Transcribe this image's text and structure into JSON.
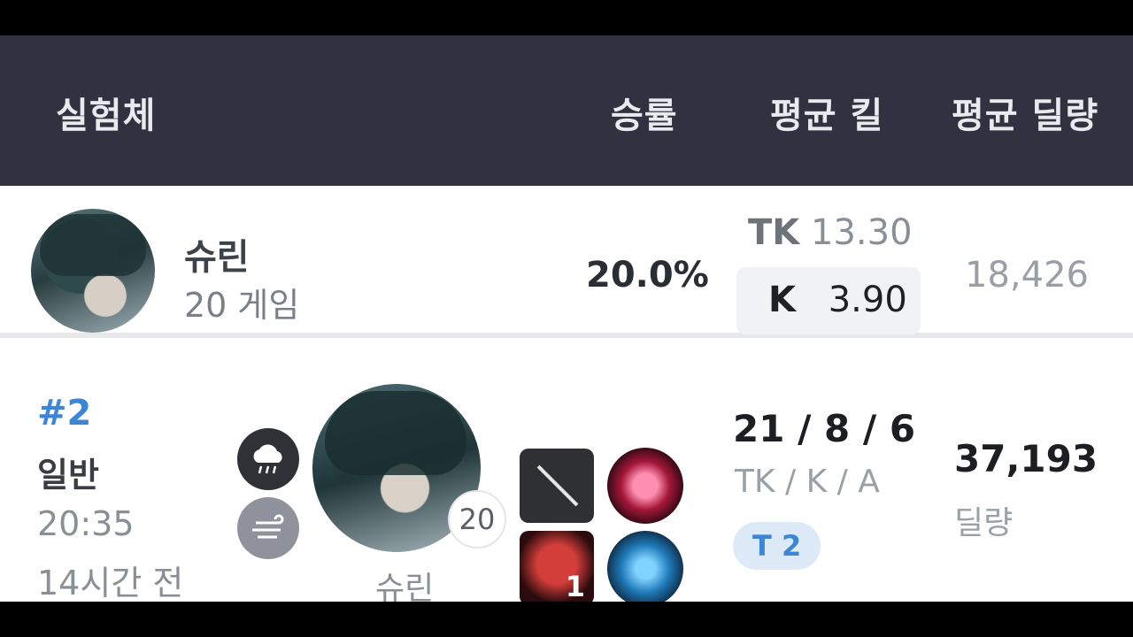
{
  "header": {
    "subject": "실험체",
    "win_rate": "승률",
    "avg_kill": "평균 킬",
    "avg_damage": "평균 딜량"
  },
  "summary": {
    "character": "슈린",
    "games": "20 게임",
    "win_rate": "20.0%",
    "tk_label": "TK",
    "tk_value": "13.30",
    "k_label": "K",
    "k_value": "3.90",
    "avg_damage": "18,426"
  },
  "match": {
    "rank": "#2",
    "mode": "일반",
    "time": "20:35",
    "ago": "14시간 전",
    "weather_icons": [
      "rain-cloud-icon",
      "fog-icon"
    ],
    "character": "슈린",
    "level": "20",
    "augment_count": "1",
    "kda": "21 / 8 / 6",
    "kda_label": "TK / K / A",
    "team": "T 2",
    "damage": "37,193",
    "damage_label": "딜량"
  }
}
